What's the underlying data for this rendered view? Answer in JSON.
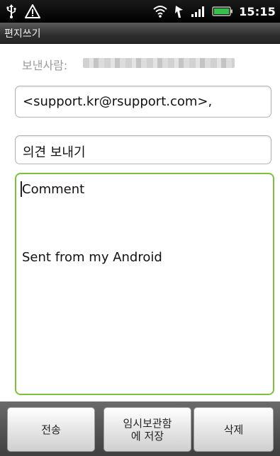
{
  "status_bar": {
    "time": "15:15",
    "icons": [
      "usb-icon",
      "warning-icon",
      "wifi-icon",
      "location-icon",
      "signal-icon",
      "battery-icon"
    ]
  },
  "title_bar": {
    "title": "편지쓰기"
  },
  "compose": {
    "sender_label": "보낸사람:",
    "to_value": "<support.kr@rsupport.com>,",
    "subject_value": "의견 보내기",
    "body_first_line": "Comment",
    "body_signature": "Sent from my Android"
  },
  "buttons": {
    "send": "전송",
    "save_draft_line1": "임시보관함",
    "save_draft_line2": "에 저장",
    "delete": "삭제"
  },
  "colors": {
    "status_bar_bg": "#000000",
    "title_bar_bg": "#3a3a3a",
    "focus_border": "#7cc13a",
    "battery": "#36c24a"
  }
}
